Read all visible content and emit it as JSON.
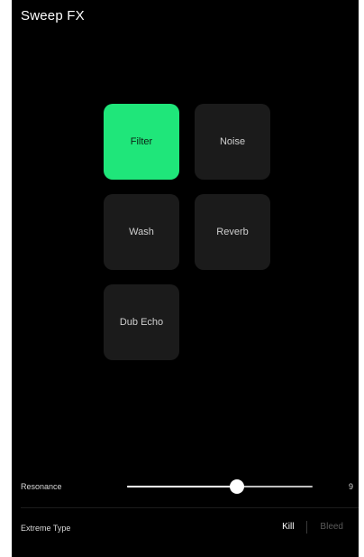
{
  "app": {
    "title": "Sweep FX"
  },
  "colors": {
    "background": "#000000",
    "pad": "#1b1b1b",
    "pad_active": "#1fe67a",
    "text_dim": "#5a5a5a"
  },
  "pads": [
    {
      "label": "Filter",
      "active": true
    },
    {
      "label": "Noise",
      "active": false
    },
    {
      "label": "Wash",
      "active": false
    },
    {
      "label": "Reverb",
      "active": false
    },
    {
      "label": "Dub Echo",
      "active": false
    }
  ],
  "resonance": {
    "label": "Resonance",
    "value_text": "9",
    "fraction": 0.59
  },
  "extreme_type": {
    "label": "Extreme Type",
    "options": [
      "Kill",
      "Bleed"
    ],
    "selected": "Kill"
  }
}
